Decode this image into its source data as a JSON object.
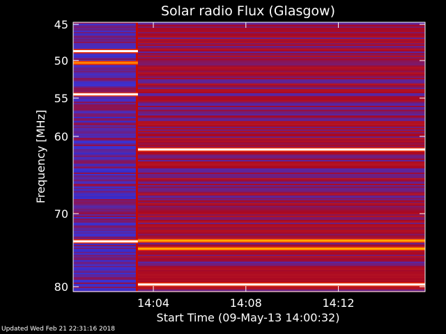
{
  "chart_data": {
    "type": "heatmap",
    "title": "Solar radio Flux (Glasgow)",
    "xlabel": "Start Time (09-May-13 14:00:32)",
    "ylabel": "Frequency [MHz]",
    "x_unit": "time (HH:MM)",
    "xlim": [
      "14:00:32",
      "14:15:45"
    ],
    "ylim": [
      45,
      80
    ],
    "y_reversed": true,
    "y_scale": "nonlinear",
    "y_ticks": [
      45,
      50,
      55,
      60,
      70,
      80
    ],
    "x_ticks": [
      "14:04",
      "14:08",
      "14:12"
    ],
    "grid": false,
    "colormap": [
      "#000018",
      "#0000a0",
      "#1e3cff",
      "#c00000",
      "#ff4000",
      "#ffc000",
      "#ffffff"
    ],
    "background_intensity": 0.45,
    "data_gap_end": "14:03:20",
    "bright_bands": [
      {
        "freq_mhz": 48.7,
        "x_start": "14:00:32",
        "x_end": "14:03:20",
        "intensity": 1.0
      },
      {
        "freq_mhz": 50.3,
        "x_start": "14:00:32",
        "x_end": "14:03:20",
        "intensity": 0.75
      },
      {
        "freq_mhz": 54.5,
        "x_start": "14:00:32",
        "x_end": "14:03:20",
        "intensity": 1.0
      },
      {
        "freq_mhz": 73.8,
        "x_start": "14:00:32",
        "x_end": "14:03:20",
        "intensity": 1.0
      },
      {
        "freq_mhz": 61.7,
        "x_start": "14:03:20",
        "x_end": "14:15:45",
        "intensity": 1.0
      },
      {
        "freq_mhz": 73.7,
        "x_start": "14:03:20",
        "x_end": "14:15:45",
        "intensity": 0.8
      },
      {
        "freq_mhz": 74.8,
        "x_start": "14:03:20",
        "x_end": "14:15:45",
        "intensity": 0.8
      },
      {
        "freq_mhz": 79.7,
        "x_start": "14:03:20",
        "x_end": "14:15:45",
        "intensity": 1.0
      }
    ]
  },
  "footer": "Updated Wed Feb 21 22:31:16 2018"
}
